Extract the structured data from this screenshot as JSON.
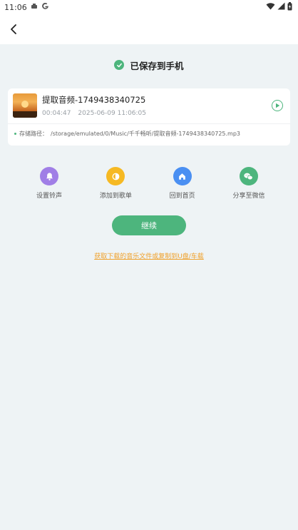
{
  "status_bar": {
    "time": "11:06"
  },
  "header": {
    "back_icon": "arrow-left-icon"
  },
  "saved_notice": {
    "text": "已保存到手机",
    "color": "#4db57d"
  },
  "track": {
    "title": "提取音频-1749438340725",
    "duration": "00:04:47",
    "datetime": "2025-06-09 11:06:05",
    "path_label": "存储路径：",
    "path": "/storage/emulated/0/Music/千千畅听/提取音频-1749438340725.mp3"
  },
  "actions": [
    {
      "label": "设置铃声",
      "icon": "bell-icon",
      "color": "#a07ee6"
    },
    {
      "label": "添加到歌单",
      "icon": "playlist-add-icon",
      "color": "#f6b923"
    },
    {
      "label": "回到首页",
      "icon": "home-icon",
      "color": "#4a8ff2"
    },
    {
      "label": "分享至微信",
      "icon": "wechat-icon",
      "color": "#4db57d"
    }
  ],
  "continue_button": {
    "label": "继续"
  },
  "help_link": {
    "text": "获取下载的音乐文件或复制到U盘/车载",
    "color": "#f0a12b"
  }
}
